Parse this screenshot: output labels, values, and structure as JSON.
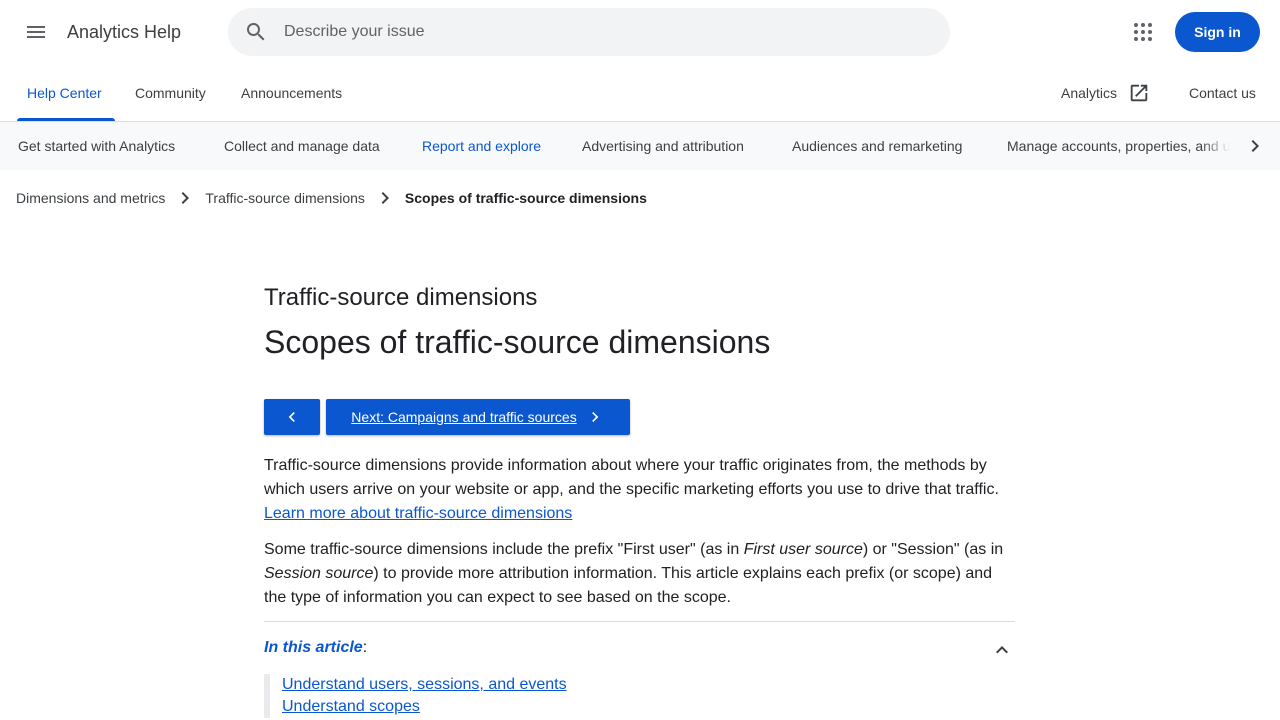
{
  "header": {
    "app_title": "Analytics Help",
    "search_placeholder": "Describe your issue",
    "search_value": "",
    "signin_label": "Sign in",
    "icons": {
      "menu": "menu-icon",
      "search": "search-icon",
      "apps": "apps-grid-icon"
    }
  },
  "tabs": {
    "items": [
      {
        "label": "Help Center",
        "active": true
      },
      {
        "label": "Community",
        "active": false
      },
      {
        "label": "Announcements",
        "active": false
      }
    ],
    "product_link": "Analytics",
    "contact_link": "Contact us"
  },
  "categories": {
    "items": [
      {
        "label": "Get started with Analytics",
        "active": false
      },
      {
        "label": "Collect and manage data",
        "active": false
      },
      {
        "label": "Report and explore",
        "active": true
      },
      {
        "label": "Advertising and attribution",
        "active": false
      },
      {
        "label": "Audiences and remarketing",
        "active": false
      },
      {
        "label": "Manage accounts, properties, and users",
        "active": false
      }
    ]
  },
  "breadcrumb": [
    "Dimensions and metrics",
    "Traffic-source dimensions",
    "Scopes of traffic-source dimensions"
  ],
  "article": {
    "kicker": "Traffic-source dimensions",
    "title": "Scopes of traffic-source dimensions",
    "next_button": "Next: Campaigns and traffic sources",
    "para1_text": "Traffic-source dimensions provide information about where your traffic originates from, the methods by which users arrive on your website or app, and the specific marketing efforts you use to drive that traffic. ",
    "para1_link": "Learn more about traffic-source dimensions",
    "para2_a": "Some traffic-source dimensions include the prefix \"First user\" (as in ",
    "para2_em1": "First user source",
    "para2_b": ") or \"Session\" (as in ",
    "para2_em2": "Session source",
    "para2_c": ") to provide more attribution information. This article explains each prefix (or scope) and the type of information you can expect to see based on the scope.",
    "toc_label": "In this article",
    "toc_colon": ":",
    "toc_items": [
      "Understand users, sessions, and events",
      "Understand scopes"
    ]
  },
  "colors": {
    "accent": "#0b57d0",
    "text": "#202124",
    "nav_background": "#f8f9fa",
    "search_background": "#f1f3f4"
  }
}
